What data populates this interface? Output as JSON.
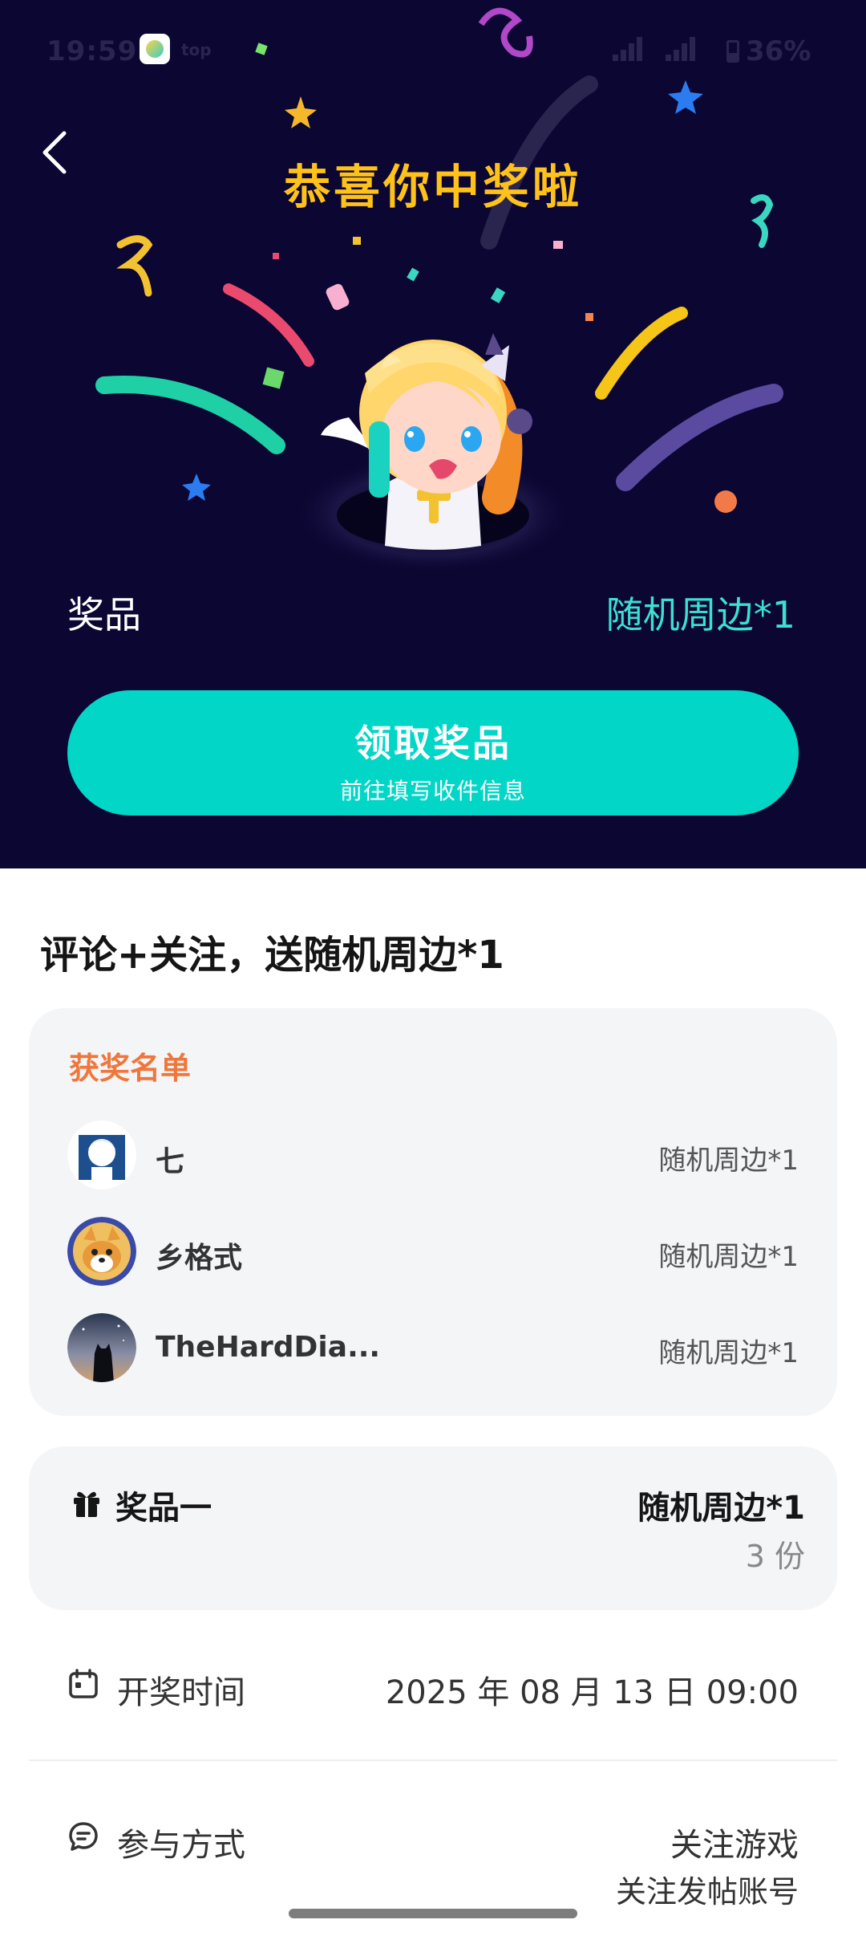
{
  "status_bar": {
    "time": "19:59",
    "extra": "top",
    "signal": "5G",
    "battery": "36%"
  },
  "header": {
    "title": "恭喜你中奖啦"
  },
  "prize": {
    "label": "奖品",
    "value": "随机周边*1"
  },
  "claim": {
    "title": "领取奖品",
    "subtitle": "前往填写收件信息"
  },
  "activity": {
    "title": "评论+关注，送随机周边*1"
  },
  "winners": {
    "heading": "获奖名单",
    "items": [
      {
        "name": "七",
        "prize": "随机周边*1"
      },
      {
        "name": "乡格式",
        "prize": "随机周边*1"
      },
      {
        "name": "TheHardDia...",
        "prize": "随机周边*1"
      }
    ]
  },
  "prize_item": {
    "label": "奖品一",
    "value": "随机周边*1",
    "count": "3 份"
  },
  "draw_time": {
    "label": "开奖时间",
    "value": "2025 年 08 月 13 日 09:00"
  },
  "participation": {
    "label": "参与方式",
    "method1": "关注游戏",
    "method2": "关注发帖账号"
  },
  "colors": {
    "hero_bg": "#0b0632",
    "title_yellow": "#ffc21a",
    "accent_teal": "#02d6c6",
    "winners_orange": "#f0773c"
  }
}
